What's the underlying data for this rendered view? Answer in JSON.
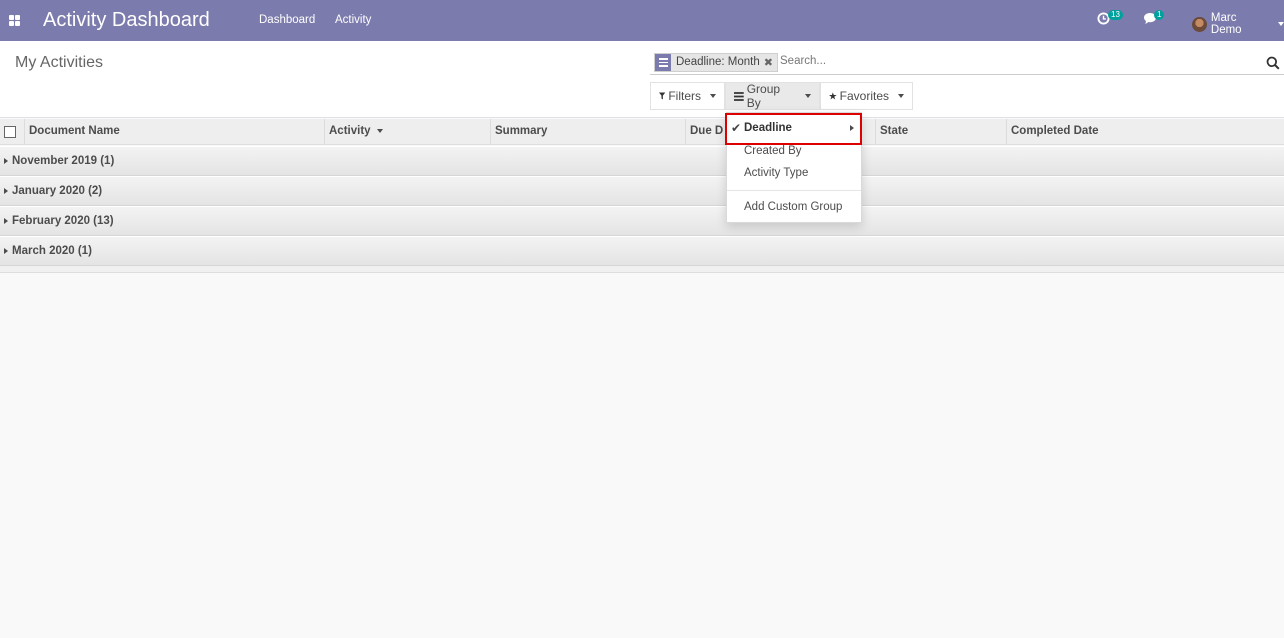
{
  "navbar": {
    "title": "Activity Dashboard",
    "menu": [
      "Dashboard",
      "Activity"
    ],
    "activity_count": "13",
    "message_count": "1",
    "user_name": "Marc Demo"
  },
  "control_panel": {
    "page_title": "My Activities",
    "facet_label": "Deadline: Month",
    "search_placeholder": "Search...",
    "filters_label": "Filters",
    "group_by_label": "Group By",
    "favorites_label": "Favorites"
  },
  "table": {
    "columns": [
      "Document Name",
      "Activity",
      "Summary",
      "Due D",
      "State",
      "Completed Date"
    ],
    "groups": [
      "November 2019 (1)",
      "January 2020 (2)",
      "February 2020 (13)",
      "March 2020 (1)"
    ]
  },
  "group_by_menu": {
    "items": [
      "Deadline",
      "Created By",
      "Activity Type"
    ],
    "add_custom": "Add Custom Group"
  },
  "colors": {
    "navbar": "#7c7bad",
    "badge": "#00a09d",
    "highlight": "#dd0000"
  }
}
